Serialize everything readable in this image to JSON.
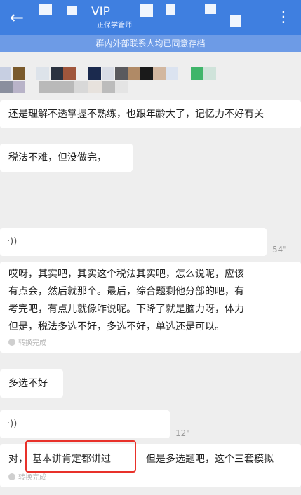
{
  "header": {
    "back_icon": "arrow-left-icon",
    "title": "VIP",
    "subtitle": "正保学管师",
    "more_icon": "more-vertical-icon",
    "bg_color": "#3f7fe0"
  },
  "notice": {
    "text": "群内外部联系人均已同意存档"
  },
  "messages": {
    "m1": {
      "text": "还是理解不透掌握不熟练，也跟年龄大了，记忆力不好有关"
    },
    "m2": {
      "text": "税法不难，但没做完，"
    },
    "v1": {
      "duration": "54\""
    },
    "m3": {
      "line1": "哎呀，其实吧，其实这个税法其实吧，怎么说呢，应该",
      "line2": "有点会，然后就那个。最后，综合题剩他分部的吧，有",
      "line3": "考完吧，有点儿就像咋说呢。下降了就是脑力呀，体力",
      "line4": "但是，税法多选不好，多选不好，单选还是可以。",
      "status": "转换完成"
    },
    "m4": {
      "text": "多选不好"
    },
    "v2": {
      "duration": "12\""
    },
    "m5": {
      "prefix": "对，",
      "highlight": "基本讲肯定都讲过",
      "suffix": "但是多选题吧，这个三套模拟",
      "status": "转换完成"
    }
  },
  "colors": {
    "highlight_border": "#e8312a",
    "notice_bg": "#6d9be6"
  }
}
